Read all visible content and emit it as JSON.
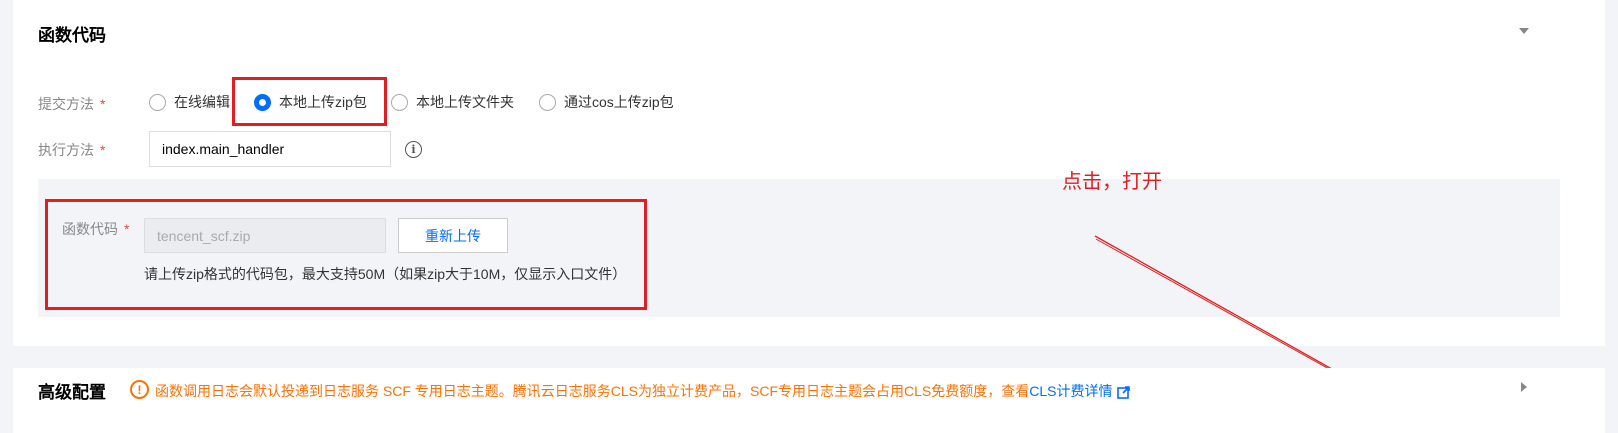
{
  "code_section": {
    "title": "函数代码",
    "submit_label": "提交方法",
    "required_mark": "*",
    "options": [
      "在线编辑",
      "本地上传zip包",
      "本地上传文件夹",
      "通过cos上传zip包"
    ],
    "selected_option": "本地上传zip包",
    "handler_label": "执行方法",
    "handler_value": "index.main_handler",
    "code_label": "函数代码",
    "code_placeholder": "tencent_scf.zip",
    "reupload_button": "重新上传",
    "hint": "请上传zip格式的代码包，最大支持50M（如果zip大于10M，仅显示入口文件）"
  },
  "advanced_section": {
    "title": "高级配置",
    "notice_text": "函数调用日志会默认投递到日志服务 SCF 专用日志主题。腾讯云日志服务CLS为独立计费产品，SCF专用日志主题会占用CLS免费额度，查看",
    "notice_link": "CLS计费详情"
  },
  "annotation": {
    "text": "点击，打开",
    "color": "#e02020"
  },
  "colors": {
    "accent": "#006eff",
    "warning": "#ff7200",
    "required": "#e54545",
    "annotation": "#e02020"
  }
}
